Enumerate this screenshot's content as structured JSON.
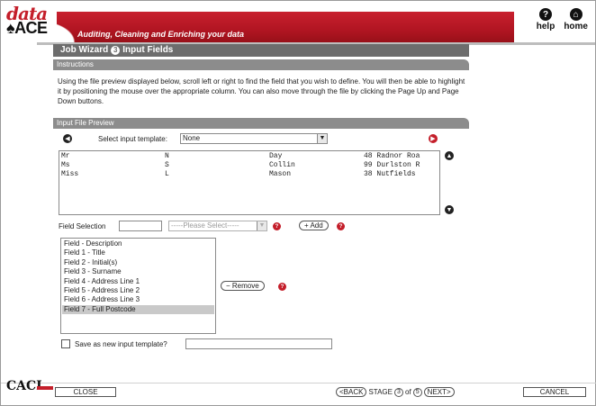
{
  "app": {
    "logo_top": "data",
    "logo_bottom": "ACE",
    "tagline": "Auditing, Cleaning and Enriching your data",
    "help_label": "help",
    "home_label": "home",
    "help_icon": "?",
    "home_icon": "⌂",
    "brand_color": "#c41e2a"
  },
  "wizard": {
    "title": "Job Wizard",
    "step_number": "3",
    "step_title": "Input Fields"
  },
  "instructions": {
    "header": "Instructions",
    "text": "Using the file preview displayed below, scroll left or right to find the field that you wish to define. You will then be able to highlight it by positioning the mouse over the appropriate column. You can also move through the file by clicking the Page Up and Page Down buttons."
  },
  "preview": {
    "header": "Input File Preview",
    "template_label": "Select input template:",
    "template_value": "None",
    "rows": [
      [
        "Mr",
        "N",
        "Day",
        "48 Radnor Roa"
      ],
      [
        "Ms",
        "S",
        "Collin",
        "99 Durlston R"
      ],
      [
        "Miss",
        "L",
        "Mason",
        "38 Nutfields"
      ]
    ]
  },
  "field_selection": {
    "label": "Field Selection",
    "input_value": "",
    "select_placeholder": "-----Please Select-----",
    "add_label": "+ Add",
    "remove_label": "− Remove",
    "items": [
      "Field - Description",
      "Field 1 - Title",
      "Field 2 - Initial(s)",
      "Field 3 - Surname",
      "Field 4 - Address Line 1",
      "Field 5 - Address Line 2",
      "Field 6 - Address Line 3",
      "Field 7 - Full Postcode"
    ],
    "selected_item": "Field 7 - Full Postcode"
  },
  "save_template": {
    "label": "Save as new input template?",
    "checked": false,
    "input_value": ""
  },
  "footer": {
    "brand": "CACI",
    "close_label": "CLOSE",
    "back_label": "<BACK",
    "stage_label": "STAGE",
    "stage_current": "3",
    "stage_of": "of",
    "stage_total": "5",
    "next_label": "NEXT>",
    "cancel_label": "CANCEL"
  }
}
